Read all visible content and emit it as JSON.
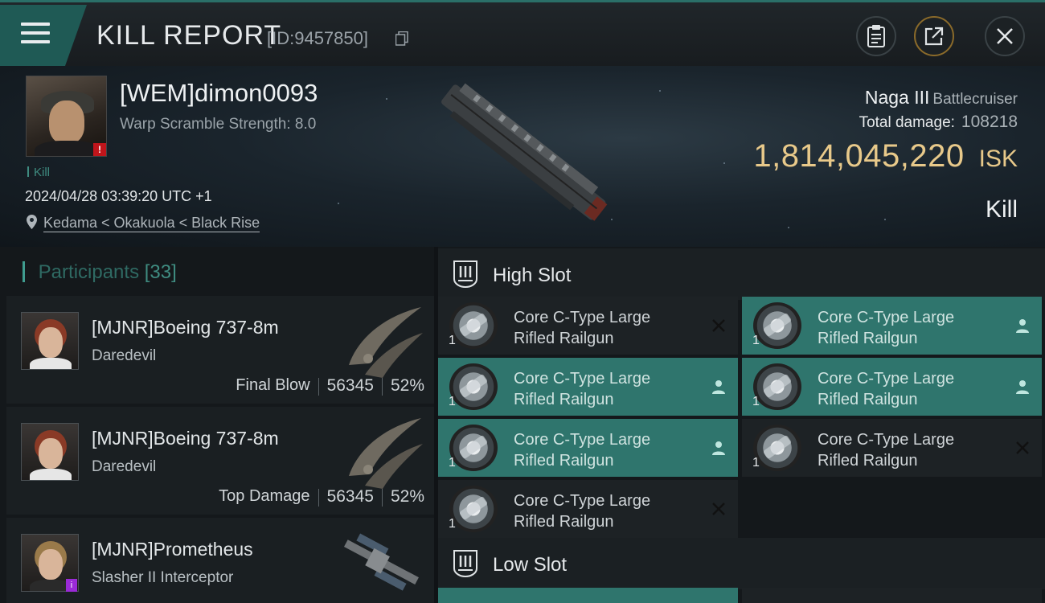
{
  "header": {
    "title": "KILL REPORT",
    "report_id": "[ID:9457850]"
  },
  "victim": {
    "pilot_name": "[WEM]dimon0093",
    "warp_scramble": "Warp Scramble Strength: 8.0",
    "kill_tag": "Kill",
    "datetime": "2024/04/28 03:39:20 UTC +1",
    "location": "Kedama < Okakuola < Black Rise",
    "ship_name": "Naga III",
    "ship_class": "Battlecruiser",
    "total_damage_label": "Total damage:",
    "total_damage_value": "108218",
    "isk_amount": "1,814,045,220",
    "isk_unit": "ISK",
    "result": "Kill"
  },
  "participants": {
    "label": "Participants",
    "count": "[33]",
    "items": [
      {
        "name": "[MJNR]Boeing 737-8m",
        "ship": "Daredevil",
        "stat_label": "Final Blow",
        "damage": "56345",
        "percent": "52%"
      },
      {
        "name": "[MJNR]Boeing 737-8m",
        "ship": "Daredevil",
        "stat_label": "Top Damage",
        "damage": "56345",
        "percent": "52%"
      },
      {
        "name": "[MJNR]Prometheus",
        "ship": "Slasher II Interceptor"
      }
    ]
  },
  "slots": {
    "high_title": "High Slot",
    "low_title": "Low Slot",
    "modules": [
      {
        "line1": "Core C-Type Large",
        "line2": "Rifled Railgun",
        "qty": "1",
        "status": "destroyed",
        "highlight": false
      },
      {
        "line1": "Core C-Type Large",
        "line2": "Rifled Railgun",
        "qty": "1",
        "status": "dropped",
        "highlight": true
      },
      {
        "line1": "Core C-Type Large",
        "line2": "Rifled Railgun",
        "qty": "1",
        "status": "dropped",
        "highlight": true
      },
      {
        "line1": "Core C-Type Large",
        "line2": "Rifled Railgun",
        "qty": "1",
        "status": "dropped",
        "highlight": true
      },
      {
        "line1": "Core C-Type Large",
        "line2": "Rifled Railgun",
        "qty": "1",
        "status": "dropped",
        "highlight": true
      },
      {
        "line1": "Core C-Type Large",
        "line2": "Rifled Railgun",
        "qty": "1",
        "status": "destroyed",
        "highlight": false
      },
      {
        "line1": "Core C-Type Large",
        "line2": "Rifled Railgun",
        "qty": "1",
        "status": "destroyed",
        "highlight": false
      }
    ]
  },
  "colors": {
    "accent_teal": "#2f756d",
    "isk_gold": "#e8c98a",
    "alert_red": "#c0151b"
  }
}
